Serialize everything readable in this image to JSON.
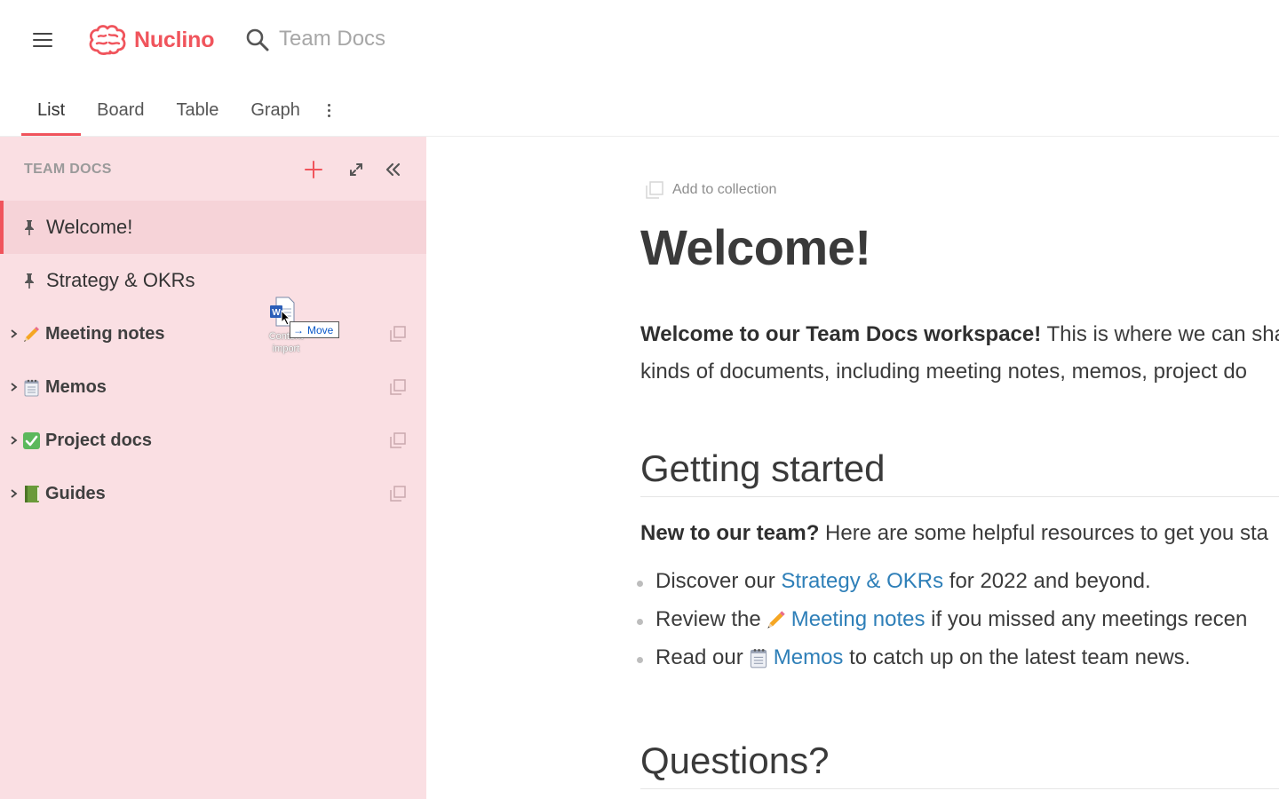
{
  "app": {
    "name": "Nuclino",
    "brand_color": "#f0545c"
  },
  "search": {
    "placeholder": "Team Docs"
  },
  "view_tabs": [
    {
      "label": "List",
      "active": true
    },
    {
      "label": "Board",
      "active": false
    },
    {
      "label": "Table",
      "active": false
    },
    {
      "label": "Graph",
      "active": false
    }
  ],
  "sidebar": {
    "title": "TEAM DOCS",
    "items": [
      {
        "label": "Welcome!",
        "type": "pinned",
        "active": true
      },
      {
        "label": "Strategy & OKRs",
        "type": "pinned",
        "active": false
      },
      {
        "label": "Meeting notes",
        "type": "cluster",
        "icon": "pencil-icon"
      },
      {
        "label": "Memos",
        "type": "cluster",
        "icon": "spiral-notepad-icon"
      },
      {
        "label": "Project docs",
        "type": "cluster",
        "icon": "check-mark-icon"
      },
      {
        "label": "Guides",
        "type": "cluster",
        "icon": "green-book-icon"
      }
    ]
  },
  "drag": {
    "file_name": "Content import",
    "action": "Move"
  },
  "doc": {
    "add_collection": "Add to collection",
    "title": "Welcome!",
    "intro_bold": "Welcome to our Team Docs workspace!",
    "intro_rest": " This is where we can sha",
    "intro_line2": "kinds of documents, including meeting notes, memos, project do",
    "section1": "Getting started",
    "new_bold": "New to our team?",
    "new_rest": " Here are some helpful resources to get you sta",
    "bullets": [
      {
        "pre": "Discover our ",
        "link": "Strategy & OKRs",
        "post": " for 2022 and beyond."
      },
      {
        "pre": "Review the",
        "link": "Meeting notes",
        "post": " if you missed any meetings recen"
      },
      {
        "pre": "Read our",
        "link": "Memos",
        "post": " to catch up on the latest team news."
      }
    ],
    "section2": "Questions?"
  }
}
